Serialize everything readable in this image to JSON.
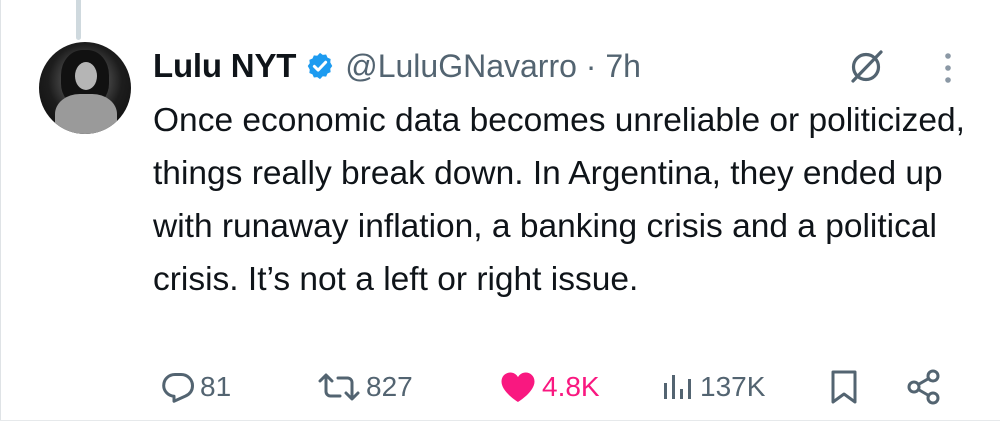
{
  "tweet": {
    "author_name": "Lulu NYT",
    "handle_time": "@LuluGNavarro · 7h",
    "text": "Once economic data becomes unreliable or politicized, things really break down. In Argentina, they ended up with runaway inflation, a banking crisis and a political crisis. It’s not a left or right issue.",
    "verified_color": "#1d9bf0",
    "like_color": "#f91880"
  },
  "actions": {
    "replies": "81",
    "reposts": "827",
    "likes": "4.8K",
    "views": "137K"
  },
  "icons": [
    "reply-icon",
    "repost-icon",
    "like-icon",
    "views-icon",
    "bookmark-icon",
    "share-icon",
    "grok-icon",
    "more-icon",
    "verified-badge-icon"
  ]
}
